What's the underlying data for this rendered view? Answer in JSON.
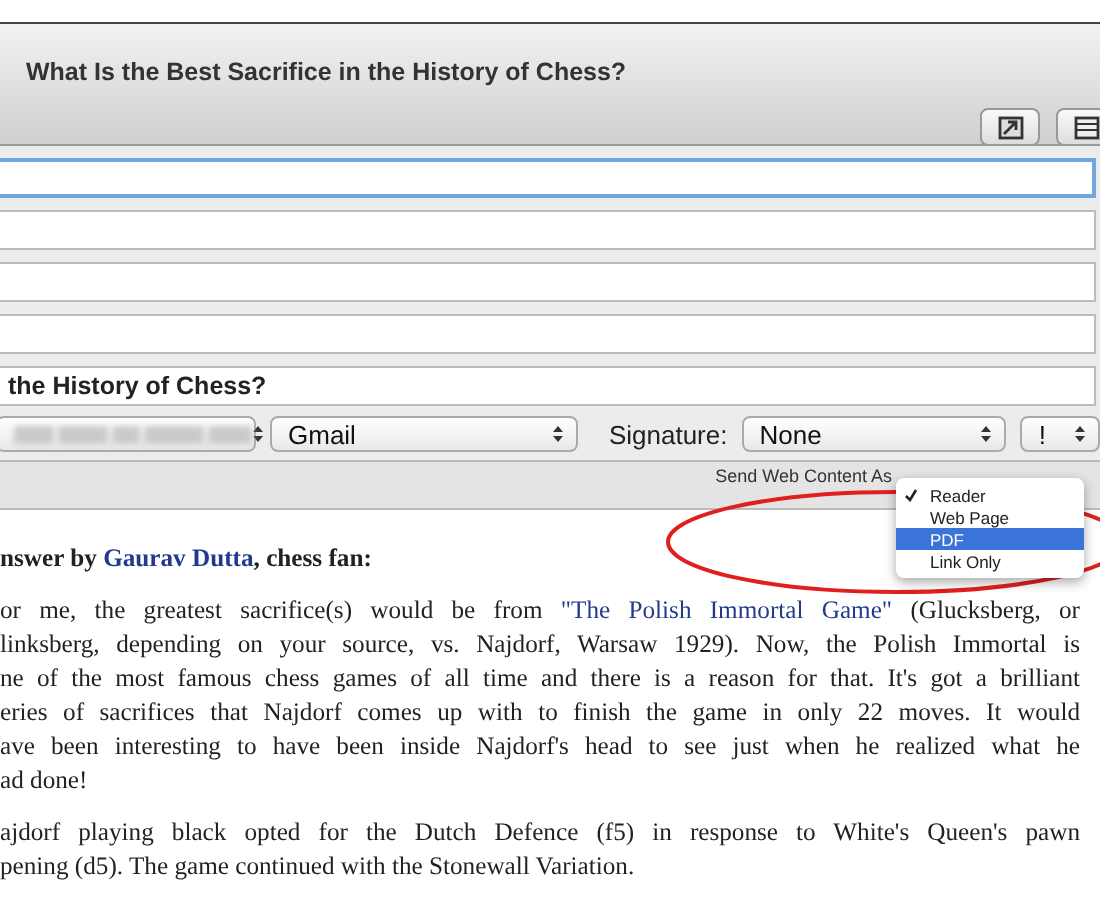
{
  "window": {
    "title": "What Is the Best Sacrifice in the History of Chess?"
  },
  "fields": [
    {
      "focused": true
    },
    {
      "focused": false
    },
    {
      "focused": false
    },
    {
      "focused": false
    },
    {
      "value": "the History of Chess?",
      "focused": false
    }
  ],
  "popups": [
    {
      "kind": "blurred"
    },
    {
      "kind": "plain",
      "value": "Gmail"
    }
  ],
  "signature": {
    "label": "Signature:",
    "value": "None"
  },
  "priority": {
    "value": "!"
  },
  "send_as": {
    "label": "Send Web Content As",
    "options": [
      {
        "label": "Reader",
        "checked": true,
        "selected": false
      },
      {
        "label": "Web Page",
        "checked": false,
        "selected": false
      },
      {
        "label": "PDF",
        "checked": false,
        "selected": true
      },
      {
        "label": "Link Only",
        "checked": false,
        "selected": false
      }
    ]
  },
  "article": [
    {
      "kind": "heading",
      "lines": [
        [
          {
            "kind": "plain",
            "text": "nswer by "
          },
          {
            "kind": "link",
            "text": "Gaurav Dutta"
          },
          {
            "kind": "plain",
            "text": ", chess fan:"
          }
        ]
      ]
    },
    {
      "kind": "paragraph",
      "lines": [
        [
          {
            "kind": "plain",
            "text": "or me, the greatest sacrifice(s) would be from "
          },
          {
            "kind": "link",
            "text": "\"The Polish Immortal Game\""
          },
          {
            "kind": "plain",
            "text": " (Glucksberg, or"
          }
        ],
        [
          {
            "kind": "plain",
            "text": "linksberg, depending on your source, vs. Najdorf, Warsaw 1929). Now, the Polish Immortal is"
          }
        ],
        [
          {
            "kind": "plain",
            "text": "ne of the most famous chess games of all time and there is a reason for that. It's got a brilliant"
          }
        ],
        [
          {
            "kind": "plain",
            "text": "eries of sacrifices that Najdorf comes up with to finish the game in only 22 moves. It would"
          }
        ],
        [
          {
            "kind": "plain",
            "text": "ave been interesting to have been inside Najdorf's head to see just when he realized what he"
          }
        ],
        [
          {
            "kind": "plain",
            "text": "ad done!"
          }
        ]
      ]
    },
    {
      "kind": "paragraph",
      "lines": [
        [
          {
            "kind": "plain",
            "text": "ajdorf playing black opted for the Dutch Defence (f5) in response to White's Queen's pawn"
          }
        ],
        [
          {
            "kind": "plain",
            "text": "pening (d5). The game continued with the Stonewall Variation."
          }
        ]
      ]
    }
  ]
}
